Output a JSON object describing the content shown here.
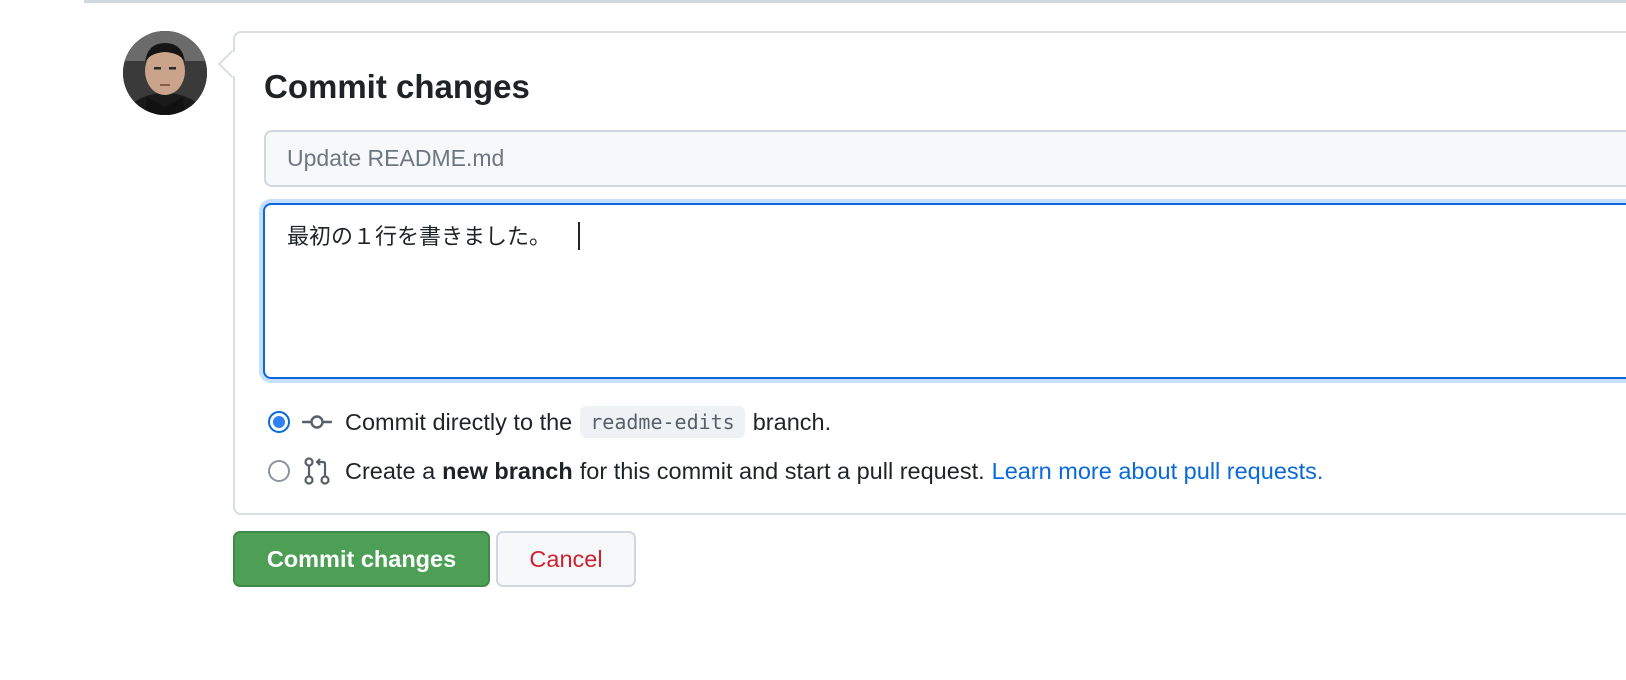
{
  "commit_form": {
    "title": "Commit changes",
    "summary_placeholder": "Update README.md",
    "description_value": "最初の１行を書きました。",
    "options": {
      "direct": {
        "selected": true,
        "text_before": "Commit directly to the",
        "branch_name": "readme-edits",
        "text_after": "branch."
      },
      "new_branch": {
        "selected": false,
        "text_before": "Create a",
        "bold_text": "new branch",
        "text_after": "for this commit and start a pull request.",
        "link_text": "Learn more about pull requests."
      }
    },
    "buttons": {
      "commit_label": "Commit changes",
      "cancel_label": "Cancel"
    }
  },
  "colors": {
    "commit_button": "#4c9f55",
    "cancel_text": "#cf222e",
    "link": "#0969da",
    "focus_border": "#0969da"
  },
  "icons": {
    "avatar": "user-avatar",
    "direct_commit": "git-commit-icon",
    "new_branch": "git-pull-request-icon"
  }
}
